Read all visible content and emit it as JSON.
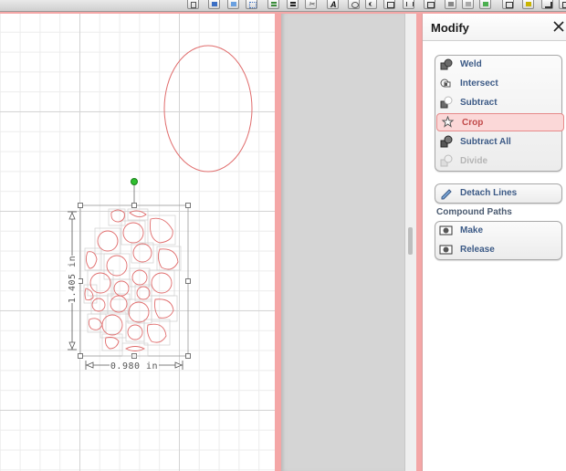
{
  "toolbar": {
    "icons": [
      "page-icon",
      "import-icon",
      "window-icon",
      "grid-icon",
      "align-icon",
      "lines-icon",
      "scissors-icon",
      "text-icon",
      "weld-icon",
      "curve-icon",
      "node-icon",
      "trace-icon",
      "shape-icon",
      "fill-icon",
      "color-icon",
      "layer-icon",
      "cut-icon",
      "pen-icon",
      "corner-icon"
    ]
  },
  "canvas": {
    "dimensions": {
      "height": "1.405 in",
      "width": "0.980 in"
    },
    "colors": {
      "shape_stroke": "#e06c6c",
      "selection_box": "#777777",
      "rotate_handle": "#2fbf2f"
    }
  },
  "panel": {
    "title": "Modify",
    "modify_items": [
      {
        "label": "Weld",
        "icon": "weld-icon",
        "state": "normal"
      },
      {
        "label": "Intersect",
        "icon": "intersect-icon",
        "state": "normal"
      },
      {
        "label": "Subtract",
        "icon": "subtract-icon",
        "state": "normal"
      },
      {
        "label": "Crop",
        "icon": "crop-icon",
        "state": "selected"
      },
      {
        "label": "Subtract All",
        "icon": "subtract-all-icon",
        "state": "normal"
      },
      {
        "label": "Divide",
        "icon": "divide-icon",
        "state": "disabled"
      }
    ],
    "detach_label": "Detach Lines",
    "compound_paths_label": "Compound Paths",
    "compound_items": [
      {
        "label": "Make",
        "icon": "make-compound-icon"
      },
      {
        "label": "Release",
        "icon": "release-compound-icon"
      }
    ]
  }
}
